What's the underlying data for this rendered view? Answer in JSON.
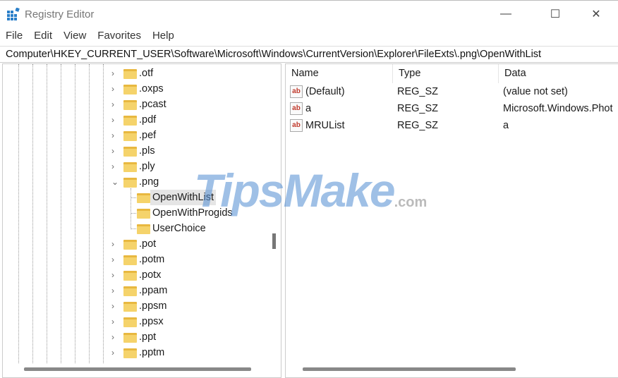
{
  "window": {
    "title": "Registry Editor",
    "minimize": "—",
    "maximize": "☐",
    "close": "✕"
  },
  "menu": [
    "File",
    "Edit",
    "View",
    "Favorites",
    "Help"
  ],
  "address": "Computer\\HKEY_CURRENT_USER\\Software\\Microsoft\\Windows\\CurrentVersion\\Explorer\\FileExts\\.png\\OpenWithList",
  "tree": [
    {
      "label": ".otf",
      "level": 0,
      "expanded": false
    },
    {
      "label": ".oxps",
      "level": 0,
      "expanded": false
    },
    {
      "label": ".pcast",
      "level": 0,
      "expanded": false
    },
    {
      "label": ".pdf",
      "level": 0,
      "expanded": false
    },
    {
      "label": ".pef",
      "level": 0,
      "expanded": false
    },
    {
      "label": ".pls",
      "level": 0,
      "expanded": false
    },
    {
      "label": ".ply",
      "level": 0,
      "expanded": false
    },
    {
      "label": ".png",
      "level": 0,
      "expanded": true
    },
    {
      "label": "OpenWithList",
      "level": 1,
      "selected": true
    },
    {
      "label": "OpenWithProgids",
      "level": 1
    },
    {
      "label": "UserChoice",
      "level": 1
    },
    {
      "label": ".pot",
      "level": 0,
      "expanded": false
    },
    {
      "label": ".potm",
      "level": 0,
      "expanded": false
    },
    {
      "label": ".potx",
      "level": 0,
      "expanded": false
    },
    {
      "label": ".ppam",
      "level": 0,
      "expanded": false
    },
    {
      "label": ".ppsm",
      "level": 0,
      "expanded": false
    },
    {
      "label": ".ppsx",
      "level": 0,
      "expanded": false
    },
    {
      "label": ".ppt",
      "level": 0,
      "expanded": false
    },
    {
      "label": ".pptm",
      "level": 0,
      "expanded": false
    }
  ],
  "columns": [
    "Name",
    "Type",
    "Data"
  ],
  "values": [
    {
      "name": "(Default)",
      "type": "REG_SZ",
      "data": "(value not set)",
      "icon": "ab"
    },
    {
      "name": "a",
      "type": "REG_SZ",
      "data": "Microsoft.Windows.Phot",
      "icon": "ab"
    },
    {
      "name": "MRUList",
      "type": "REG_SZ",
      "data": "a",
      "icon": "ab"
    }
  ],
  "watermark": {
    "main": "TipsMake",
    "suffix": ".com"
  }
}
